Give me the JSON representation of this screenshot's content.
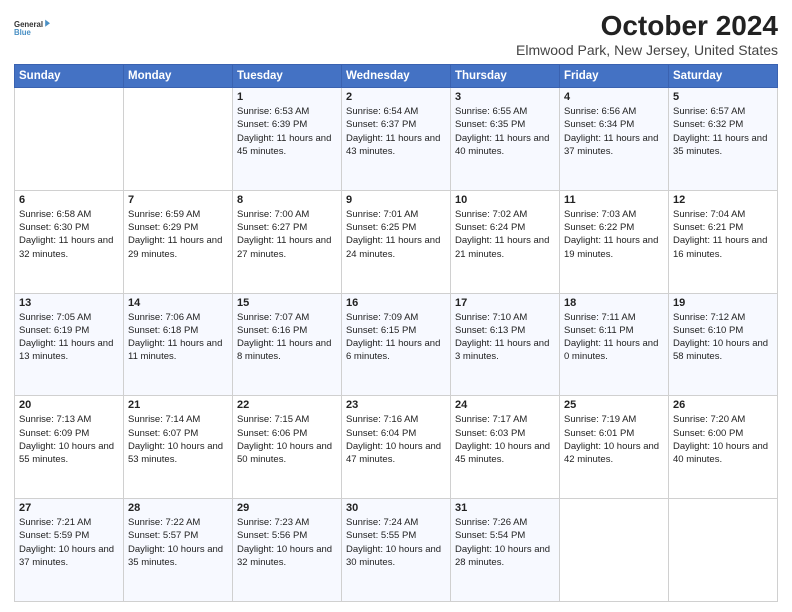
{
  "header": {
    "logo_line1": "General",
    "logo_line2": "Blue",
    "title": "October 2024",
    "subtitle": "Elmwood Park, New Jersey, United States"
  },
  "columns": [
    "Sunday",
    "Monday",
    "Tuesday",
    "Wednesday",
    "Thursday",
    "Friday",
    "Saturday"
  ],
  "weeks": [
    [
      {
        "day": "",
        "info": ""
      },
      {
        "day": "",
        "info": ""
      },
      {
        "day": "1",
        "info": "Sunrise: 6:53 AM\nSunset: 6:39 PM\nDaylight: 11 hours and 45 minutes."
      },
      {
        "day": "2",
        "info": "Sunrise: 6:54 AM\nSunset: 6:37 PM\nDaylight: 11 hours and 43 minutes."
      },
      {
        "day": "3",
        "info": "Sunrise: 6:55 AM\nSunset: 6:35 PM\nDaylight: 11 hours and 40 minutes."
      },
      {
        "day": "4",
        "info": "Sunrise: 6:56 AM\nSunset: 6:34 PM\nDaylight: 11 hours and 37 minutes."
      },
      {
        "day": "5",
        "info": "Sunrise: 6:57 AM\nSunset: 6:32 PM\nDaylight: 11 hours and 35 minutes."
      }
    ],
    [
      {
        "day": "6",
        "info": "Sunrise: 6:58 AM\nSunset: 6:30 PM\nDaylight: 11 hours and 32 minutes."
      },
      {
        "day": "7",
        "info": "Sunrise: 6:59 AM\nSunset: 6:29 PM\nDaylight: 11 hours and 29 minutes."
      },
      {
        "day": "8",
        "info": "Sunrise: 7:00 AM\nSunset: 6:27 PM\nDaylight: 11 hours and 27 minutes."
      },
      {
        "day": "9",
        "info": "Sunrise: 7:01 AM\nSunset: 6:25 PM\nDaylight: 11 hours and 24 minutes."
      },
      {
        "day": "10",
        "info": "Sunrise: 7:02 AM\nSunset: 6:24 PM\nDaylight: 11 hours and 21 minutes."
      },
      {
        "day": "11",
        "info": "Sunrise: 7:03 AM\nSunset: 6:22 PM\nDaylight: 11 hours and 19 minutes."
      },
      {
        "day": "12",
        "info": "Sunrise: 7:04 AM\nSunset: 6:21 PM\nDaylight: 11 hours and 16 minutes."
      }
    ],
    [
      {
        "day": "13",
        "info": "Sunrise: 7:05 AM\nSunset: 6:19 PM\nDaylight: 11 hours and 13 minutes."
      },
      {
        "day": "14",
        "info": "Sunrise: 7:06 AM\nSunset: 6:18 PM\nDaylight: 11 hours and 11 minutes."
      },
      {
        "day": "15",
        "info": "Sunrise: 7:07 AM\nSunset: 6:16 PM\nDaylight: 11 hours and 8 minutes."
      },
      {
        "day": "16",
        "info": "Sunrise: 7:09 AM\nSunset: 6:15 PM\nDaylight: 11 hours and 6 minutes."
      },
      {
        "day": "17",
        "info": "Sunrise: 7:10 AM\nSunset: 6:13 PM\nDaylight: 11 hours and 3 minutes."
      },
      {
        "day": "18",
        "info": "Sunrise: 7:11 AM\nSunset: 6:11 PM\nDaylight: 11 hours and 0 minutes."
      },
      {
        "day": "19",
        "info": "Sunrise: 7:12 AM\nSunset: 6:10 PM\nDaylight: 10 hours and 58 minutes."
      }
    ],
    [
      {
        "day": "20",
        "info": "Sunrise: 7:13 AM\nSunset: 6:09 PM\nDaylight: 10 hours and 55 minutes."
      },
      {
        "day": "21",
        "info": "Sunrise: 7:14 AM\nSunset: 6:07 PM\nDaylight: 10 hours and 53 minutes."
      },
      {
        "day": "22",
        "info": "Sunrise: 7:15 AM\nSunset: 6:06 PM\nDaylight: 10 hours and 50 minutes."
      },
      {
        "day": "23",
        "info": "Sunrise: 7:16 AM\nSunset: 6:04 PM\nDaylight: 10 hours and 47 minutes."
      },
      {
        "day": "24",
        "info": "Sunrise: 7:17 AM\nSunset: 6:03 PM\nDaylight: 10 hours and 45 minutes."
      },
      {
        "day": "25",
        "info": "Sunrise: 7:19 AM\nSunset: 6:01 PM\nDaylight: 10 hours and 42 minutes."
      },
      {
        "day": "26",
        "info": "Sunrise: 7:20 AM\nSunset: 6:00 PM\nDaylight: 10 hours and 40 minutes."
      }
    ],
    [
      {
        "day": "27",
        "info": "Sunrise: 7:21 AM\nSunset: 5:59 PM\nDaylight: 10 hours and 37 minutes."
      },
      {
        "day": "28",
        "info": "Sunrise: 7:22 AM\nSunset: 5:57 PM\nDaylight: 10 hours and 35 minutes."
      },
      {
        "day": "29",
        "info": "Sunrise: 7:23 AM\nSunset: 5:56 PM\nDaylight: 10 hours and 32 minutes."
      },
      {
        "day": "30",
        "info": "Sunrise: 7:24 AM\nSunset: 5:55 PM\nDaylight: 10 hours and 30 minutes."
      },
      {
        "day": "31",
        "info": "Sunrise: 7:26 AM\nSunset: 5:54 PM\nDaylight: 10 hours and 28 minutes."
      },
      {
        "day": "",
        "info": ""
      },
      {
        "day": "",
        "info": ""
      }
    ]
  ]
}
